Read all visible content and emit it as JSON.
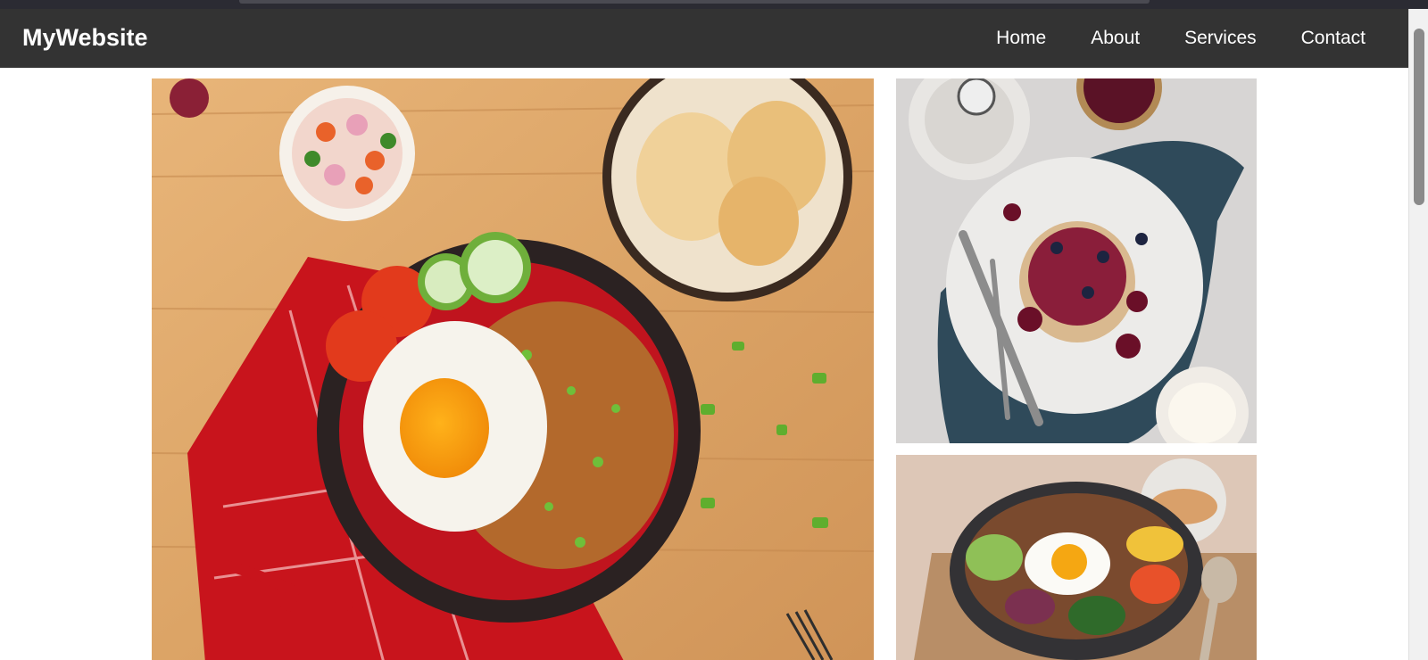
{
  "site": {
    "brand": "MyWebsite"
  },
  "nav": {
    "items": [
      {
        "label": "Home"
      },
      {
        "label": "About"
      },
      {
        "label": "Services"
      },
      {
        "label": "Contact"
      }
    ]
  },
  "gallery": {
    "images": [
      {
        "subject": "fried-rice-with-egg-and-vegetables"
      },
      {
        "subject": "pancakes-with-berries"
      },
      {
        "subject": "bibimbap-stone-bowl"
      }
    ]
  },
  "colors": {
    "navbar": "#333333",
    "nav_text": "#ffffff",
    "page_background": "#ffffff"
  }
}
